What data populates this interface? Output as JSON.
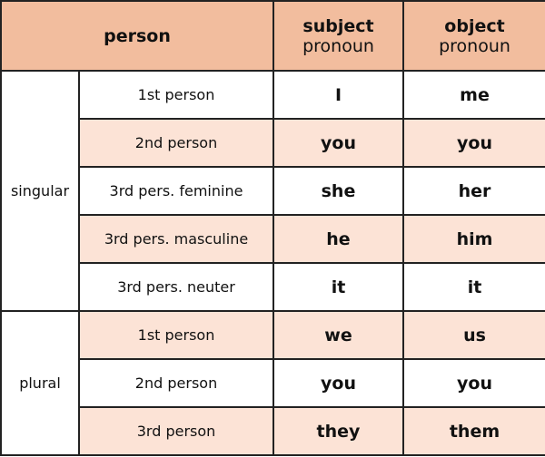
{
  "colors": {
    "header": "#f2bd9e",
    "alt_row": "#fce3d6",
    "border": "#222222"
  },
  "header": {
    "person": "person",
    "subject_line1": "subject",
    "subject_line2": "pronoun",
    "object_line1": "object",
    "object_line2": "pronoun"
  },
  "groups": [
    {
      "label": "singular",
      "rows": [
        {
          "person": "1st person",
          "subject": "I",
          "object": "me"
        },
        {
          "person": "2nd person",
          "subject": "you",
          "object": "you"
        },
        {
          "person": "3rd pers. feminine",
          "subject": "she",
          "object": "her"
        },
        {
          "person": "3rd pers. masculine",
          "subject": "he",
          "object": "him"
        },
        {
          "person": "3rd pers. neuter",
          "subject": "it",
          "object": "it"
        }
      ]
    },
    {
      "label": "plural",
      "rows": [
        {
          "person": "1st person",
          "subject": "we",
          "object": "us"
        },
        {
          "person": "2nd person",
          "subject": "you",
          "object": "you"
        },
        {
          "person": "3rd person",
          "subject": "they",
          "object": "them"
        }
      ]
    }
  ]
}
